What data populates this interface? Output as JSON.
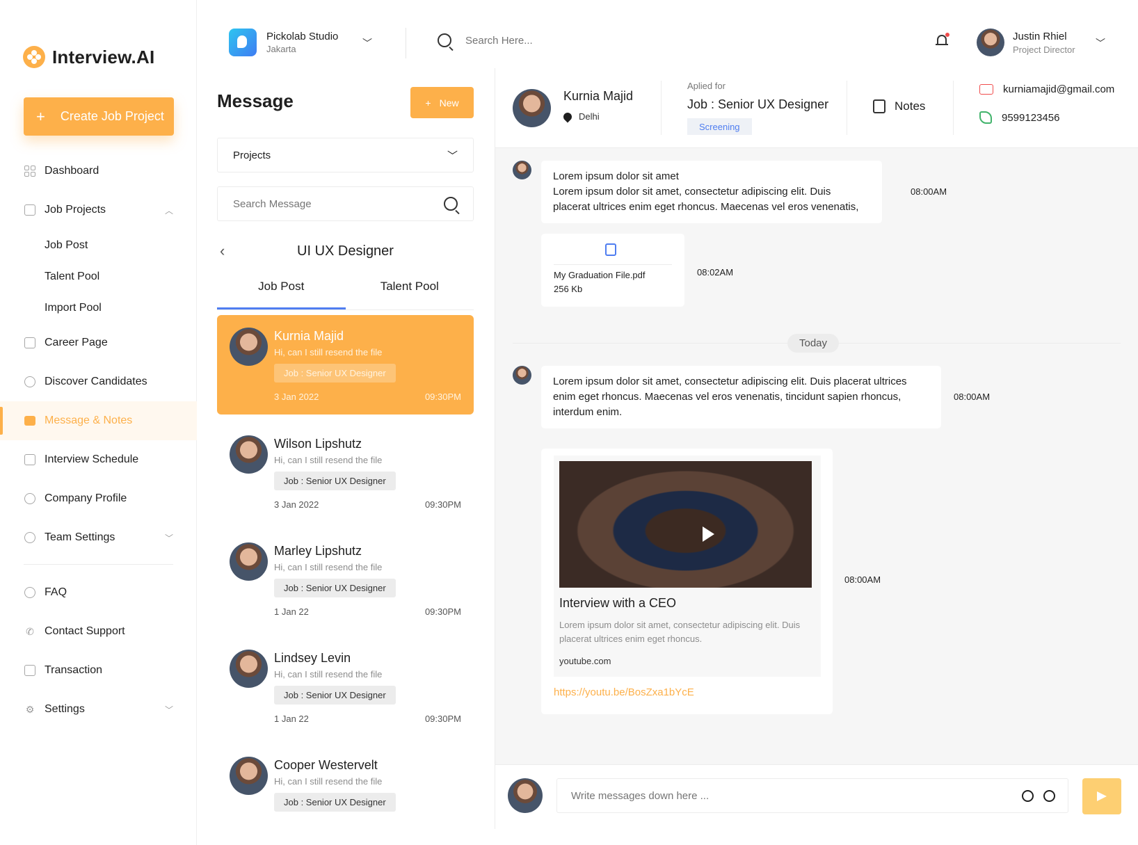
{
  "app": {
    "logo_text": "Interview.AI",
    "create_button": "Create Job Project"
  },
  "sidebar": {
    "items": [
      {
        "label": "Dashboard"
      },
      {
        "label": "Job Projects"
      },
      {
        "label": "Job Post"
      },
      {
        "label": "Talent Pool"
      },
      {
        "label": "Import Pool"
      },
      {
        "label": "Career Page"
      },
      {
        "label": "Discover Candidates"
      },
      {
        "label": "Message & Notes"
      },
      {
        "label": "Interview Schedule"
      },
      {
        "label": "Company Profile"
      },
      {
        "label": "Team Settings"
      },
      {
        "label": "FAQ"
      },
      {
        "label": "Contact Support"
      },
      {
        "label": "Transaction"
      },
      {
        "label": "Settings"
      }
    ]
  },
  "topbar": {
    "company_name": "Pickolab Studio",
    "company_location": "Jakarta",
    "search_placeholder": "Search Here...",
    "user_name": "Justin Rhiel",
    "user_role": "Project Director"
  },
  "messages": {
    "title": "Message",
    "new_button": "New",
    "projects_select": "Projects",
    "search_placeholder": "Search Message",
    "category": "UI UX Designer",
    "tabs": [
      "Job Post",
      "Talent Pool"
    ],
    "conversations": [
      {
        "name": "Kurnia Majid",
        "snippet": "Hi, can I still resend the file",
        "job": "Job : Senior UX Designer",
        "date": "3 Jan 2022",
        "time": "09:30PM"
      },
      {
        "name": "Wilson Lipshutz",
        "snippet": "Hi, can I still resend the file",
        "job": "Job : Senior UX Designer",
        "date": "3 Jan 2022",
        "time": "09:30PM"
      },
      {
        "name": "Marley Lipshutz",
        "snippet": "Hi, can I still resend the file",
        "job": "Job : Senior UX Designer",
        "date": "1 Jan 22",
        "time": "09:30PM"
      },
      {
        "name": "Lindsey Levin",
        "snippet": "Hi, can I still resend the file",
        "job": "Job : Senior UX Designer",
        "date": "1 Jan 22",
        "time": "09:30PM"
      },
      {
        "name": "Cooper Westervelt",
        "snippet": "Hi, can I still resend the file",
        "job": "Job : Senior UX Designer",
        "date": "",
        "time": ""
      }
    ]
  },
  "chat": {
    "candidate_name": "Kurnia Majid",
    "candidate_location": "Delhi",
    "applied_label": "Aplied for",
    "job": "Job : Senior UX Designer",
    "stage": "Screening",
    "notes_label": "Notes",
    "email": "kurniamajid@gmail.com",
    "phone": "9599123456",
    "msg1_line1": "Lorem ipsum dolor sit amet",
    "msg1_line2": "Lorem ipsum dolor sit amet, consectetur adipiscing elit. Duis placerat ultrices enim eget rhoncus. Maecenas vel eros venenatis,",
    "msg1_time": "08:00AM",
    "file_name": "My Graduation File.pdf",
    "file_size": "256 Kb",
    "file_time": "08:02AM",
    "day_label": "Today",
    "msg2_text": "Lorem ipsum dolor sit amet, consectetur adipiscing elit. Duis placerat ultrices enim eget rhoncus. Maecenas vel eros venenatis, tincidunt sapien rhoncus, interdum enim.",
    "msg2_time": "08:00AM",
    "video_title": "Interview with a CEO",
    "video_desc": "Lorem ipsum dolor sit amet, consectetur adipiscing elit. Duis placerat ultrices enim eget rhoncus.",
    "video_domain": "youtube.com",
    "video_link": "https://youtu.be/BosZxa1bYcE",
    "video_time": "08:00AM",
    "composer_placeholder": "Write messages down here ..."
  },
  "colors": {
    "accent": "#fdb04a",
    "link_blue": "#4f7df0",
    "mail_red": "#f04b4b",
    "phone_green": "#41b36b"
  }
}
